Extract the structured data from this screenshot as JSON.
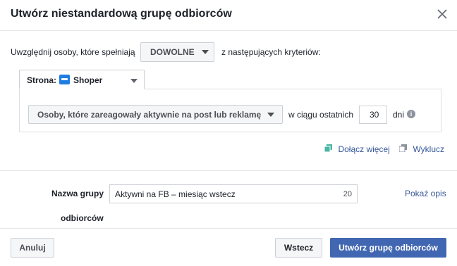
{
  "dialog": {
    "title": "Utwórz niestandardową grupę odbiorców"
  },
  "criteria": {
    "include_text": "Uwzględnij osoby, które spełniają",
    "match_value": "DOWOLNE",
    "following_text": "z następujących kryteriów:"
  },
  "source": {
    "label": "Strona:",
    "name": "Shoper"
  },
  "rule": {
    "event_value": "Osoby, które zareagowały aktywnie na post lub reklamę",
    "within_text": "w ciągu ostatnich",
    "days_value": "30",
    "days_label": "dni",
    "info_glyph": "i"
  },
  "links": {
    "include_more": "Dołącz więcej",
    "exclude": "Wyklucz",
    "show_description": "Pokaż opis"
  },
  "name_field": {
    "label_line1": "Nazwa grupy",
    "label_line2": "odbiorców",
    "value": "Aktywni na FB – miesiąc wstecz",
    "char_count": "20"
  },
  "footer": {
    "cancel": "Anuluj",
    "back": "Wstecz",
    "create": "Utwórz grupę odbiorców"
  },
  "colors": {
    "primary": "#4267b2",
    "link": "#365899",
    "link_icon": "#4cb5a5",
    "shoper_logo": "#1f7de2"
  }
}
